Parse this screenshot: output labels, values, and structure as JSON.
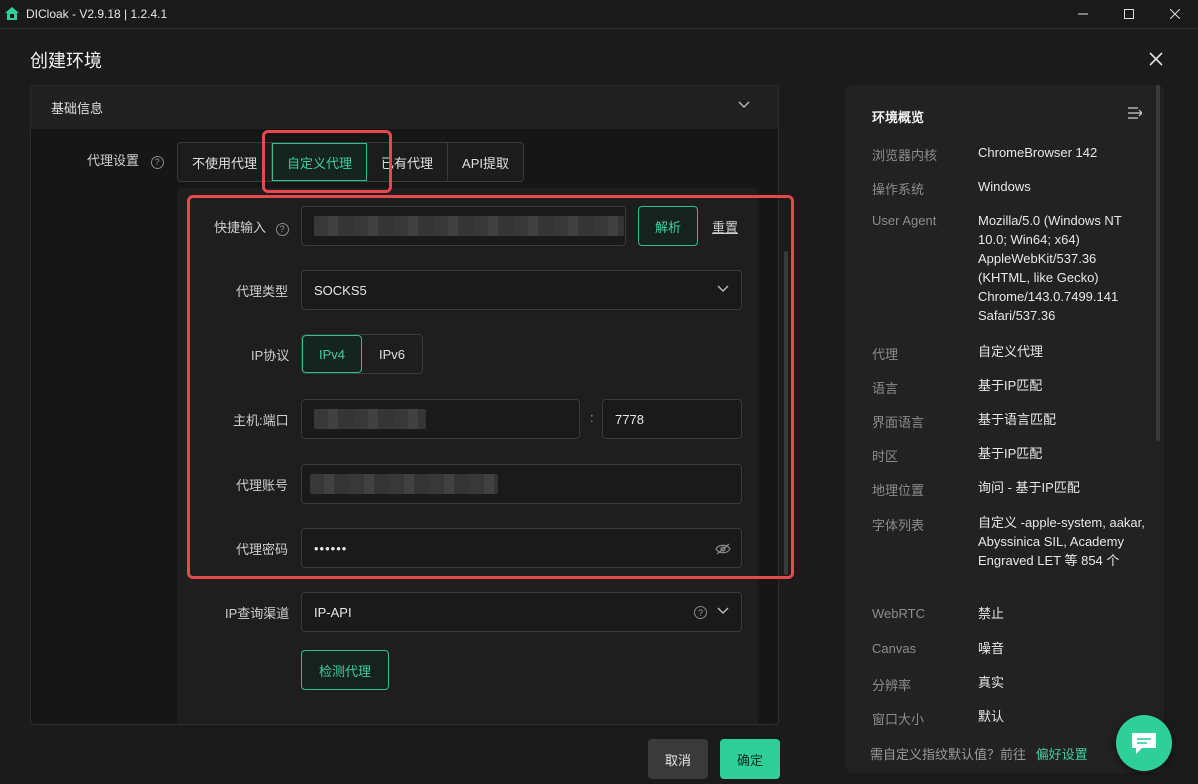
{
  "window": {
    "title": "DICloak - V2.9.18 | 1.2.4.1"
  },
  "dialog": {
    "title": "创建环境"
  },
  "section": {
    "title": "基础信息"
  },
  "proxy": {
    "label": "代理设置",
    "tabs": [
      "不使用代理",
      "自定义代理",
      "已有代理",
      "API提取"
    ],
    "active_tab": "自定义代理"
  },
  "form": {
    "quick_input_label": "快捷输入",
    "parse_button": "解析",
    "reset_link": "重置",
    "proxy_type_label": "代理类型",
    "proxy_type_value": "SOCKS5",
    "ip_protocol_label": "IP协议",
    "ip_options": [
      "IPv4",
      "IPv6"
    ],
    "host_port_label": "主机:端口",
    "port_separator": ":",
    "port_value": "7778",
    "account_label": "代理账号",
    "password_label": "代理密码",
    "password_mask": "••••••",
    "ip_channel_label": "IP查询渠道",
    "ip_channel_value": "IP-API",
    "check_button": "检测代理"
  },
  "footer": {
    "cancel": "取消",
    "confirm": "确定"
  },
  "summary": {
    "title": "环境概览",
    "rows": [
      {
        "key": "浏览器内核",
        "value": "ChromeBrowser 142"
      },
      {
        "key": "操作系统",
        "value": "Windows"
      },
      {
        "key": "User Agent",
        "value": "Mozilla/5.0 (Windows NT 10.0; Win64; x64) AppleWebKit/537.36 (KHTML, like Gecko) Chrome/143.0.7499.141 Safari/537.36"
      },
      {
        "key": "代理",
        "value": "自定义代理"
      },
      {
        "key": "语言",
        "value": "基于IP匹配"
      },
      {
        "key": "界面语言",
        "value": "基于语言匹配"
      },
      {
        "key": "时区",
        "value": "基于IP匹配"
      },
      {
        "key": "地理位置",
        "value": "询问 - 基于IP匹配"
      },
      {
        "key": "字体列表",
        "value": "自定义 -apple-system, aakar, Abyssinica SIL, Academy Engraved LET 等 854 个"
      },
      {
        "key": "WebRTC",
        "value": "禁止"
      },
      {
        "key": "Canvas",
        "value": "噪音"
      },
      {
        "key": "分辨率",
        "value": "真实"
      },
      {
        "key": "窗口大小",
        "value": "默认"
      }
    ],
    "footer_text": "需自定义指纹默认值？前往",
    "footer_link": "偏好设置"
  },
  "colors": {
    "accent": "#2fbf8c",
    "highlight": "#e5484d"
  }
}
